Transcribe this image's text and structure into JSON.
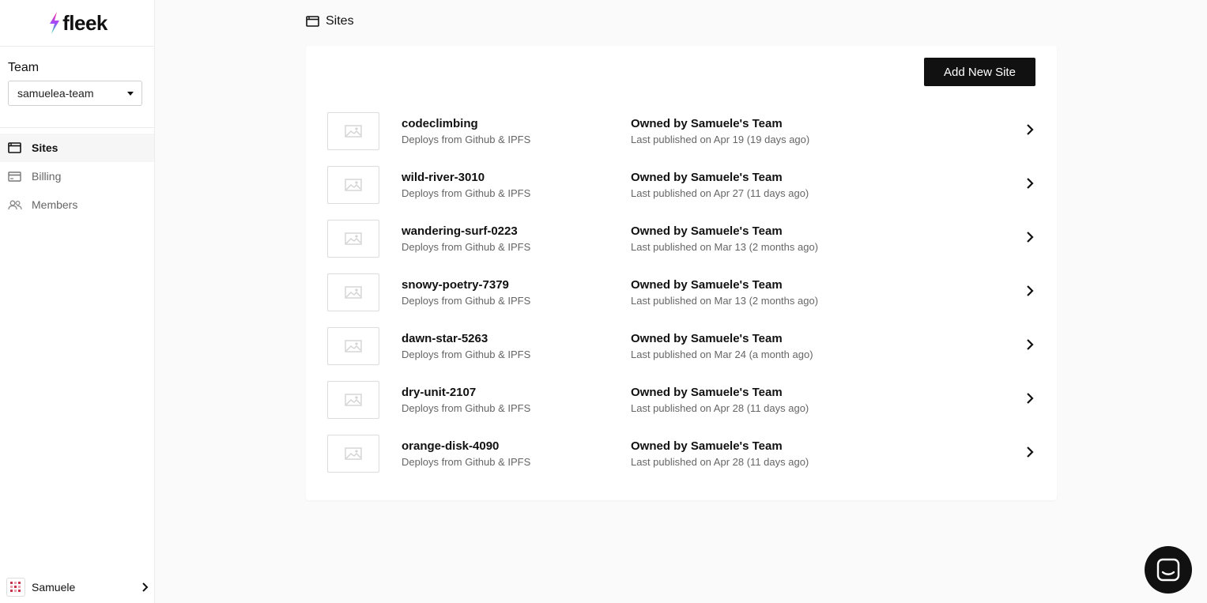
{
  "brand": {
    "name": "fleek"
  },
  "sidebar": {
    "team_label": "Team",
    "team_selected": "samuelea-team",
    "nav": [
      {
        "label": "Sites",
        "icon": "browser-window-icon",
        "active": true
      },
      {
        "label": "Billing",
        "icon": "credit-card-icon",
        "active": false
      },
      {
        "label": "Members",
        "icon": "members-icon",
        "active": false
      }
    ],
    "user": {
      "name": "Samuele"
    }
  },
  "header": {
    "title": "Sites"
  },
  "actions": {
    "add_site": "Add New Site"
  },
  "sites": [
    {
      "name": "codeclimbing",
      "deploy": "Deploys from Github & IPFS",
      "owner": "Owned by Samuele's Team",
      "published": "Last published on Apr 19 (19 days ago)"
    },
    {
      "name": "wild-river-3010",
      "deploy": "Deploys from Github & IPFS",
      "owner": "Owned by Samuele's Team",
      "published": "Last published on Apr 27 (11 days ago)"
    },
    {
      "name": "wandering-surf-0223",
      "deploy": "Deploys from Github & IPFS",
      "owner": "Owned by Samuele's Team",
      "published": "Last published on Mar 13 (2 months ago)"
    },
    {
      "name": "snowy-poetry-7379",
      "deploy": "Deploys from Github & IPFS",
      "owner": "Owned by Samuele's Team",
      "published": "Last published on Mar 13 (2 months ago)"
    },
    {
      "name": "dawn-star-5263",
      "deploy": "Deploys from Github & IPFS",
      "owner": "Owned by Samuele's Team",
      "published": "Last published on Mar 24 (a month ago)"
    },
    {
      "name": "dry-unit-2107",
      "deploy": "Deploys from Github & IPFS",
      "owner": "Owned by Samuele's Team",
      "published": "Last published on Apr 28 (11 days ago)"
    },
    {
      "name": "orange-disk-4090",
      "deploy": "Deploys from Github & IPFS",
      "owner": "Owned by Samuele's Team",
      "published": "Last published on Apr 28 (11 days ago)"
    }
  ]
}
